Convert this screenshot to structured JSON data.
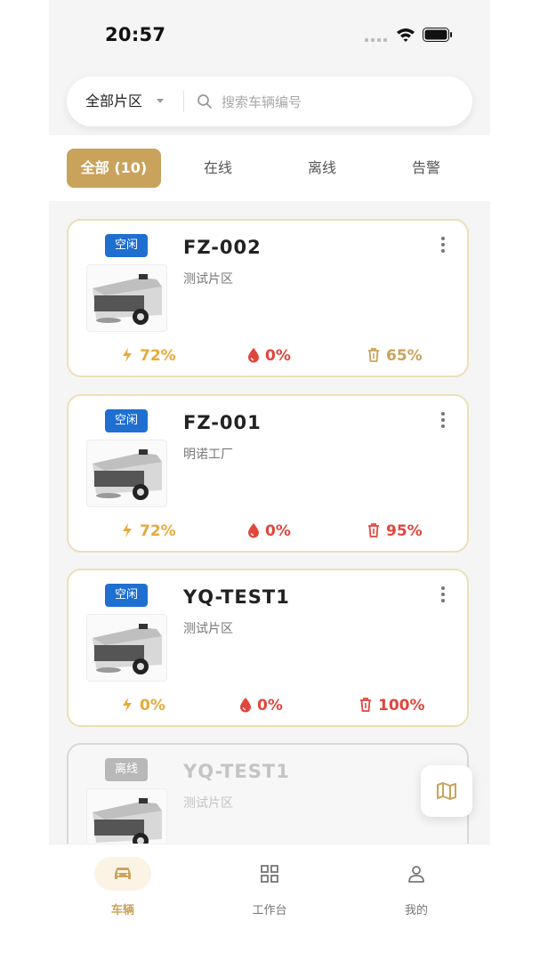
{
  "status_bar": {
    "time": "20:57"
  },
  "search": {
    "zone_label": "全部片区",
    "placeholder": "搜索车辆编号"
  },
  "tabs": [
    {
      "label": "全部 (10)",
      "active": true
    },
    {
      "label": "在线",
      "active": false
    },
    {
      "label": "离线",
      "active": false
    },
    {
      "label": "告警",
      "active": false
    }
  ],
  "vehicles": [
    {
      "status": "空闲",
      "name": "FZ-002",
      "zone": "测试片区",
      "battery": "72%",
      "water": "0%",
      "trash": "65%",
      "trash_alert": false,
      "offline": false
    },
    {
      "status": "空闲",
      "name": "FZ-001",
      "zone": "明诺工厂",
      "battery": "72%",
      "water": "0%",
      "trash": "95%",
      "trash_alert": true,
      "offline": false
    },
    {
      "status": "空闲",
      "name": "YQ-TEST1",
      "zone": "测试片区",
      "battery": "0%",
      "water": "0%",
      "trash": "100%",
      "trash_alert": true,
      "offline": false
    },
    {
      "status": "离线",
      "name": "YQ-TEST1",
      "zone": "测试片区",
      "offline": true
    }
  ],
  "bottom_nav": [
    {
      "label": "车辆",
      "icon": "car-icon",
      "active": true
    },
    {
      "label": "工作台",
      "icon": "workbench-grid-icon",
      "active": false
    },
    {
      "label": "我的",
      "icon": "user-icon",
      "active": false
    }
  ],
  "colors": {
    "accent": "#c9a35c",
    "badge_idle": "#1f6fd1",
    "badge_offline": "#b8b8b8",
    "battery": "#e8a93a",
    "alert": "#e1463c",
    "card_border": "#eedfb8"
  }
}
